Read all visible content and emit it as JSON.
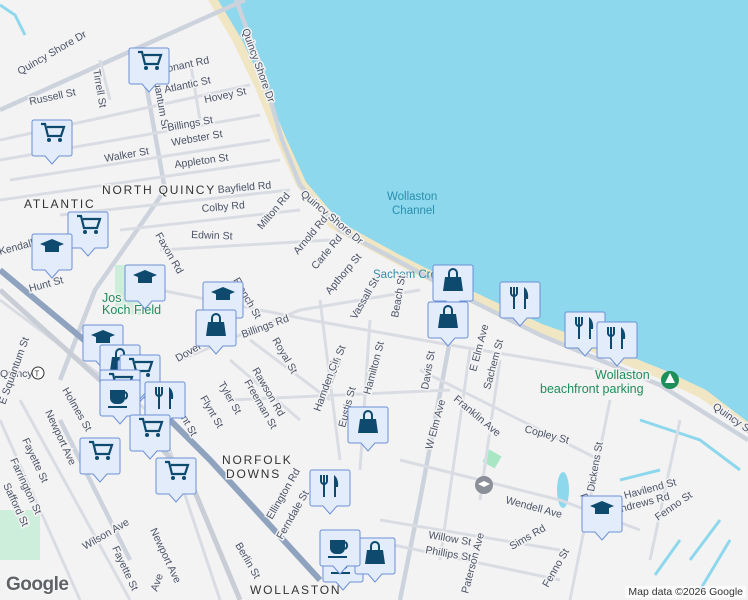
{
  "map": {
    "water_color": "#8dd8ec",
    "land_color": "#f4f3f4",
    "beach_color": "#f1e6c4",
    "marker_fill": "#e2ecfb",
    "marker_border": "#6b8fd6",
    "marker_icon_color": "#0d4a6e",
    "areas": [
      "NORTH QUINCY",
      "ATLANTIC",
      "NORFOLK",
      "DOWNS",
      "WOLLASTON"
    ],
    "water_labels": [
      "Wollaston",
      "Channel",
      "Sachem Creek"
    ],
    "pois": [
      "Wollaston",
      "beachfront parking",
      "Jos",
      "Koch Field"
    ],
    "transit": "Quincy",
    "streets": [
      "Quincy Shore Dr",
      "Tirrell St",
      "E Squantum St",
      "onant Rd",
      "Atlantic St",
      "Hovey St",
      "Russell St",
      "Quincy Shore Dr",
      "Billings St",
      "Webster St",
      "Walker St",
      "Appleton St",
      "Bayfield Rd",
      "Colby Rd",
      "Edwin St",
      "Milton Rd",
      "Faxon Rd",
      "Quincy Shore Dr",
      "Arnold Rd",
      "Carle Rd",
      "Apthorp St",
      "Hunt St",
      "Kendall St",
      "French St",
      "Billings Rd",
      "Vassall St",
      "Beach St",
      "Royal St",
      "Rawson Rd",
      "Freeman St",
      "Tyler St",
      "Flynt St",
      "Lunt St",
      "Vassall St",
      "Hamilton St",
      "Hamden Cir",
      "Eustis St",
      "Davis St",
      "W Elm Ave",
      "E Elm Ave",
      "Sachem St",
      "Franklin Ave",
      "Copley St",
      "Quincy Shore Dr",
      "Dickens St",
      "Rice Rd",
      "Havilend St",
      "Andrews Rd",
      "Fenno St",
      "Fenno St",
      "Wendell Ave",
      "Sims Rd",
      "Willow St",
      "Phillips St",
      "Paterson Ave",
      "Ellington Rd",
      "Ferndale St",
      "Berlin St",
      "Newport Ave",
      "Newport Ave",
      "Wilson Ave",
      "Fayette St",
      "Fayette St",
      "Farrington St",
      "Safford St",
      "Holmes St",
      "E Squantum St",
      "Dover Ave",
      "Ave"
    ],
    "markers": [
      "cart",
      "cart",
      "cart",
      "school",
      "school",
      "school",
      "bag",
      "school",
      "bag",
      "cart",
      "cart",
      "cart",
      "restaurant",
      "cafe",
      "cart",
      "cart",
      "cart",
      "restaurant",
      "bag",
      "bag",
      "bag",
      "restaurant",
      "restaurant",
      "restaurant",
      "school",
      "cafe",
      "bag",
      "cafe"
    ]
  },
  "attribution": "Map data ©2026 Google",
  "logo": "Google"
}
